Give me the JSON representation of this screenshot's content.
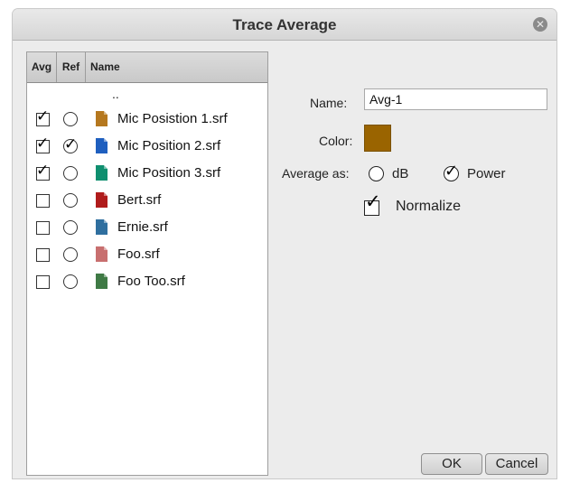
{
  "window": {
    "title": "Trace Average"
  },
  "file_list": {
    "columns": [
      "Avg",
      "Ref",
      "Name"
    ],
    "parent_entry": "..",
    "files": [
      {
        "name": "Mic Posistion 1.srf",
        "avg": true,
        "ref": false,
        "icon_color": "#b5781f"
      },
      {
        "name": "Mic Position 2.srf",
        "avg": true,
        "ref": true,
        "icon_color": "#1f5fbf"
      },
      {
        "name": "Mic Position 3.srf",
        "avg": true,
        "ref": false,
        "icon_color": "#0f8f6f"
      },
      {
        "name": "Bert.srf",
        "avg": false,
        "ref": false,
        "icon_color": "#b01c1c"
      },
      {
        "name": "Ernie.srf",
        "avg": false,
        "ref": false,
        "icon_color": "#2f6f9f"
      },
      {
        "name": "Foo.srf",
        "avg": false,
        "ref": false,
        "icon_color": "#c86f6f"
      },
      {
        "name": "Foo Too.srf",
        "avg": false,
        "ref": false,
        "icon_color": "#3f7a45"
      }
    ]
  },
  "form": {
    "name_label": "Name:",
    "name_value": "Avg-1",
    "color_label": "Color:",
    "color_value": "#9a6400",
    "average_as_label": "Average as:",
    "average_options": [
      "dB",
      "Power"
    ],
    "average_selected": "Power",
    "normalize_label": "Normalize",
    "normalize_checked": true
  },
  "buttons": {
    "ok": "OK",
    "cancel": "Cancel"
  }
}
